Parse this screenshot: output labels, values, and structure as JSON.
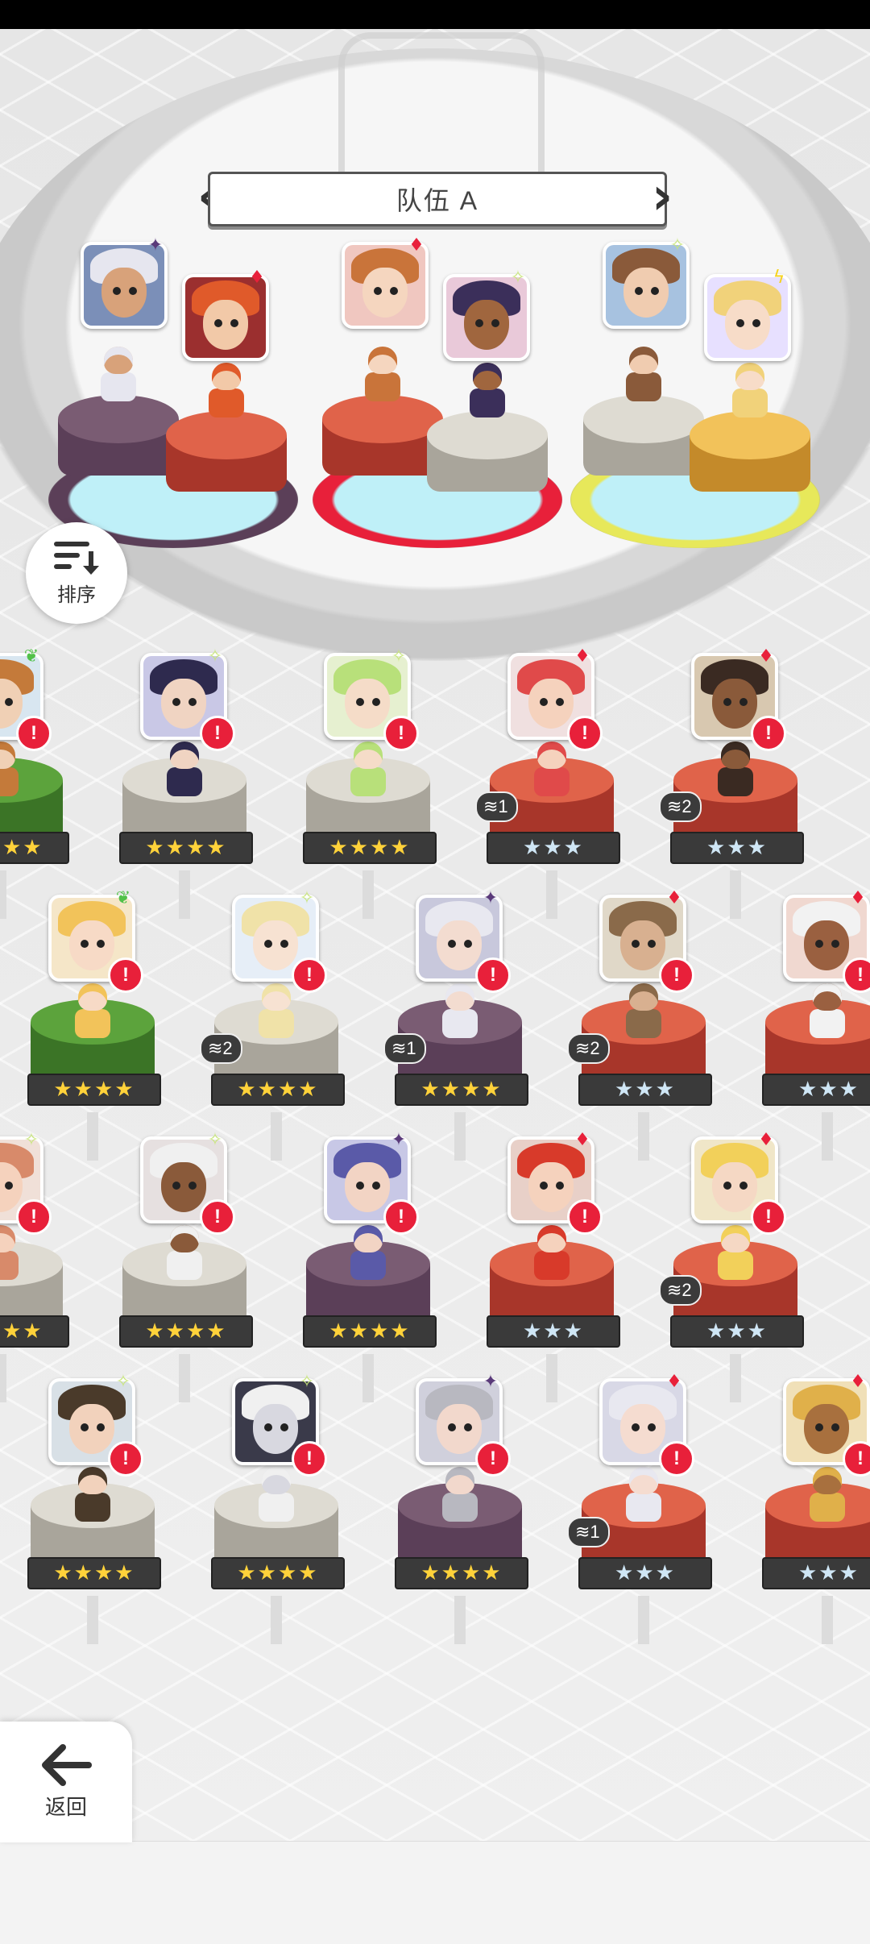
{
  "title": "队伍 A",
  "buttons": {
    "sort_label": "排序",
    "back_label": "返回"
  },
  "element_glyphs": {
    "star": "★",
    "sparkle": "✧",
    "diamond": "♦",
    "leaf": "❦",
    "bolt": "ϟ",
    "moon": "✦"
  },
  "colors": {
    "element": {
      "star": "#f59a1e",
      "sparkle": "#c8e67a",
      "diamond": "#e8203a",
      "leaf": "#52c14a",
      "bolt": "#f5d21a",
      "moon": "#5a3a7a"
    },
    "platform": {
      "purple": [
        "#7a5c73",
        "#5b3f58"
      ],
      "red": [
        "#e0634a",
        "#a8362a"
      ],
      "white": [
        "#dedbd2",
        "#a9a59b"
      ],
      "green": [
        "#5ca33c",
        "#3b7426"
      ],
      "gold": [
        "#f2c25a",
        "#c48a2a"
      ]
    },
    "ring": [
      "#5b3f58",
      "#e8203a",
      "#e7e85a"
    ]
  },
  "team": [
    {
      "name": "hero-a1",
      "element": "moon",
      "platform": "purple",
      "hair": "#e6e6ef",
      "skin": "#d8a27a",
      "bg": "#7b8fb8",
      "slot": 0
    },
    {
      "name": "hero-a2",
      "element": "diamond",
      "platform": "red",
      "hair": "#e05a2a",
      "skin": "#f2c9a8",
      "bg": "#9b2f2f",
      "slot": 1
    },
    {
      "name": "hero-a3",
      "element": "diamond",
      "platform": "red",
      "hair": "#c9743a",
      "skin": "#f5d6bf",
      "bg": "#f0c7c0",
      "slot": 2
    },
    {
      "name": "hero-a4",
      "element": "sparkle",
      "platform": "white",
      "hair": "#3b2f5a",
      "skin": "#a0663e",
      "bg": "#e9c9d9",
      "slot": 3
    },
    {
      "name": "hero-a5",
      "element": "sparkle",
      "platform": "white",
      "hair": "#8a5a3a",
      "skin": "#f0ccb0",
      "bg": "#a7c2e0",
      "slot": 4
    },
    {
      "name": "hero-a6",
      "element": "bolt",
      "platform": "gold",
      "hair": "#f1d27a",
      "skin": "#f7dcc8",
      "bg": "#e7e0ff",
      "slot": 5
    }
  ],
  "roster": [
    {
      "row": 0,
      "col": -1,
      "element": "leaf",
      "platform": "green",
      "stars": "★★★★",
      "tier": "gold",
      "dup": "",
      "hair": "#c47a3a",
      "skin": "#f0d0b5",
      "bg": "#d8e6f0"
    },
    {
      "row": 0,
      "col": 0,
      "element": "sparkle",
      "platform": "white",
      "stars": "★★★★",
      "tier": "gold",
      "dup": "",
      "hair": "#2e2a4e",
      "skin": "#f0d4c2",
      "bg": "#c9c8e6"
    },
    {
      "row": 0,
      "col": 1,
      "element": "sparkle",
      "platform": "white",
      "stars": "★★★★",
      "tier": "gold",
      "dup": "",
      "hair": "#b8e07a",
      "skin": "#f5dcc8",
      "bg": "#e6f0d0"
    },
    {
      "row": 0,
      "col": 2,
      "element": "diamond",
      "platform": "red",
      "stars": "★★★",
      "tier": "silver",
      "dup": "1",
      "hair": "#e04a4a",
      "skin": "#f5d2bd",
      "bg": "#f0e0e0"
    },
    {
      "row": 0,
      "col": 3,
      "element": "diamond",
      "platform": "red",
      "stars": "★★★",
      "tier": "silver",
      "dup": "2",
      "hair": "#3a2a22",
      "skin": "#8a5a3a",
      "bg": "#d8c8b0"
    },
    {
      "row": 1,
      "col": 0,
      "element": "leaf",
      "platform": "green",
      "stars": "★★★★",
      "tier": "gold",
      "dup": "",
      "hair": "#f2c35a",
      "skin": "#f7dac6",
      "bg": "#f5e6c8"
    },
    {
      "row": 1,
      "col": 1,
      "element": "sparkle",
      "platform": "white",
      "stars": "★★★★",
      "tier": "gold",
      "dup": "2",
      "hair": "#f0e2a8",
      "skin": "#f7e2d2",
      "bg": "#e6eef7"
    },
    {
      "row": 1,
      "col": 2,
      "element": "moon",
      "platform": "purple",
      "stars": "★★★★",
      "tier": "gold",
      "dup": "1",
      "hair": "#e8e8f0",
      "skin": "#f3dcd0",
      "bg": "#c8c8dc"
    },
    {
      "row": 1,
      "col": 3,
      "element": "diamond",
      "platform": "red",
      "stars": "★★★",
      "tier": "silver",
      "dup": "2",
      "hair": "#8a6a4a",
      "skin": "#d8b090",
      "bg": "#e0d8c8"
    },
    {
      "row": 1,
      "col": 4,
      "element": "diamond",
      "platform": "red",
      "stars": "★★★",
      "tier": "silver",
      "dup": "",
      "hair": "#f2f2f2",
      "skin": "#9a6040",
      "bg": "#f0d8d0"
    },
    {
      "row": 2,
      "col": -1,
      "element": "sparkle",
      "platform": "white",
      "stars": "★★★★",
      "tier": "gold",
      "dup": "",
      "hair": "#d88a6a",
      "skin": "#f5d2bd",
      "bg": "#f0e0d8"
    },
    {
      "row": 2,
      "col": 0,
      "element": "sparkle",
      "platform": "white",
      "stars": "★★★★",
      "tier": "gold",
      "dup": "",
      "hair": "#f0f0f0",
      "skin": "#8a5a3a",
      "bg": "#e6e0e0"
    },
    {
      "row": 2,
      "col": 1,
      "element": "moon",
      "platform": "purple",
      "stars": "★★★★",
      "tier": "gold",
      "dup": "",
      "hair": "#5a5aa8",
      "skin": "#f2d4c4",
      "bg": "#c8c8e6"
    },
    {
      "row": 2,
      "col": 2,
      "element": "diamond",
      "platform": "red",
      "stars": "★★★",
      "tier": "silver",
      "dup": "",
      "hair": "#d83a2a",
      "skin": "#f5d2bd",
      "bg": "#e8d0c8"
    },
    {
      "row": 2,
      "col": 3,
      "element": "diamond",
      "platform": "red",
      "stars": "★★★",
      "tier": "silver",
      "dup": "2",
      "hair": "#f2d05a",
      "skin": "#f5d8c4",
      "bg": "#f0e6c8"
    },
    {
      "row": 3,
      "col": 0,
      "element": "sparkle",
      "platform": "white",
      "stars": "★★★★",
      "tier": "gold",
      "dup": "",
      "hair": "#4a3a2a",
      "skin": "#f2d2bc",
      "bg": "#d8e0e6"
    },
    {
      "row": 3,
      "col": 1,
      "element": "sparkle",
      "platform": "white",
      "stars": "★★★★",
      "tier": "gold",
      "dup": "",
      "hair": "#f0f0f0",
      "skin": "#d8d8e0",
      "bg": "#3a3a4a"
    },
    {
      "row": 3,
      "col": 2,
      "element": "moon",
      "platform": "purple",
      "stars": "★★★★",
      "tier": "gold",
      "dup": "",
      "hair": "#b8b8c0",
      "skin": "#f2d8cc",
      "bg": "#d0d0dc"
    },
    {
      "row": 3,
      "col": 3,
      "element": "diamond",
      "platform": "red",
      "stars": "★★★",
      "tier": "silver",
      "dup": "1",
      "hair": "#e8e8f0",
      "skin": "#f5dcd0",
      "bg": "#d8d8e6"
    },
    {
      "row": 3,
      "col": 4,
      "element": "diamond",
      "platform": "red",
      "stars": "★★★",
      "tier": "silver",
      "dup": "",
      "hair": "#e0b04a",
      "skin": "#a8703e",
      "bg": "#f0e0b8"
    }
  ],
  "alert_glyph": "!"
}
